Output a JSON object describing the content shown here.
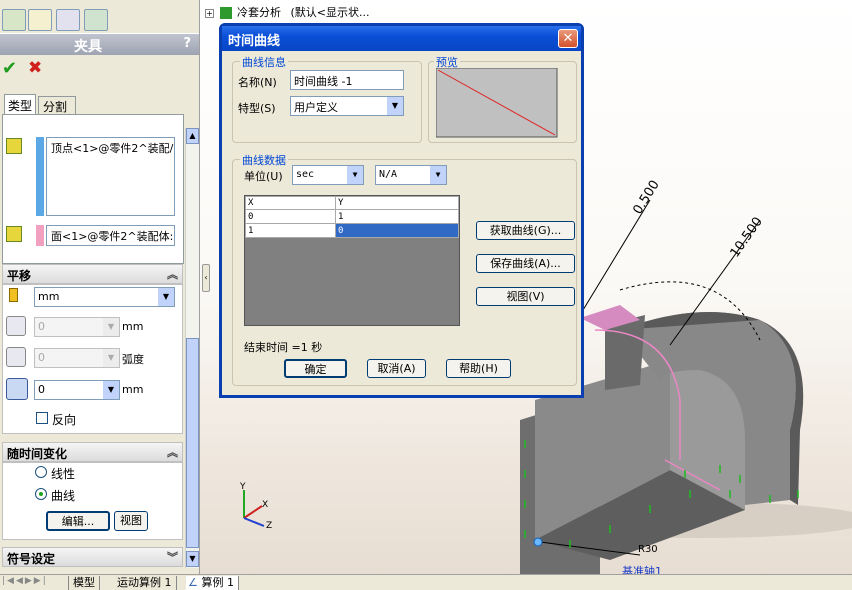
{
  "tree": {
    "item": "冷套分析",
    "config": "(默认<显示状..."
  },
  "panel": {
    "title": "夹具",
    "help": "?",
    "tabs": [
      "类型",
      "分割"
    ],
    "selection1": "顶点<1>@零件2^装配/",
    "selection2": "面<1>@零件2^装配体:",
    "translation": {
      "header": "平移",
      "unit": "mm",
      "field1": "0",
      "field1_unit": "mm",
      "field2": "0",
      "field2_unit": "弧度",
      "field3": "0",
      "field3_unit": "mm",
      "reverse": "反向"
    },
    "time_variation": {
      "header": "随时间变化",
      "linear": "线性",
      "curve": "曲线",
      "edit": "编辑...",
      "view": "视图"
    },
    "symbol": {
      "header": "符号设定"
    }
  },
  "dialog": {
    "title": "时间曲线",
    "close": "✕",
    "curve_info": "曲线信息",
    "name_label": "名称(N)",
    "name_value": "时间曲线 -1",
    "type_label": "特型(S)",
    "type_value": "用户定义",
    "preview": "预览",
    "curve_data": "曲线数据",
    "unit_label": "单位(U)",
    "unit_value": "sec",
    "unit2_value": "N/A",
    "table": {
      "headers": [
        "X",
        "Y"
      ],
      "rows": [
        [
          "0",
          "1"
        ],
        [
          "1",
          "0"
        ]
      ]
    },
    "get_curve": "获取曲线(G)...",
    "save_curve": "保存曲线(A)...",
    "view": "视图(V)",
    "end_time": "结束时间 =1 秒",
    "ok": "确定",
    "cancel": "取消(A)",
    "help": "帮助(H)"
  },
  "viewport": {
    "dim1": "0.500",
    "dim2": "10.500",
    "r_label": "R30",
    "axis_label": "基准轴1"
  },
  "axes": {
    "x": "X",
    "y": "Y",
    "z": "Z"
  },
  "bottom_tabs": [
    "模型",
    "运动算例 1",
    "算例 1"
  ],
  "colors": {
    "dialog_title": "#0a4fd8",
    "selection_blue": "#5aa9e6",
    "selection_pink": "#f2a0c0",
    "model_gray": "#7a7a7a"
  }
}
